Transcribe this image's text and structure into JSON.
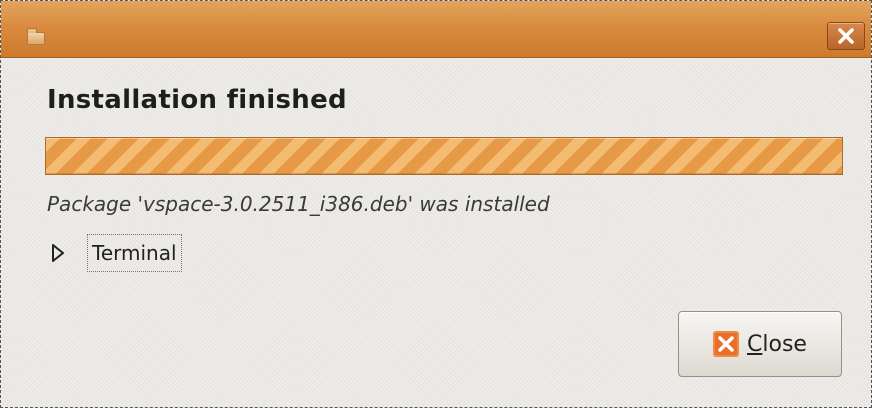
{
  "window": {
    "title": "",
    "close_icon": "close-icon"
  },
  "main": {
    "heading": "Installation finished",
    "progress": 1.0,
    "status": "Package 'vspace-3.0.2511_i386.deb' was installed",
    "expander": {
      "label": "Terminal",
      "icon": "triangle-right-icon",
      "expanded": false
    }
  },
  "footer": {
    "close_button_label": "Close",
    "close_button_icon": "close-icon"
  },
  "colors": {
    "titlebar": "#d98b3e",
    "progress_fill": "#e79a45",
    "close_icon_orange": "#e8702a",
    "background": "#efede9"
  }
}
